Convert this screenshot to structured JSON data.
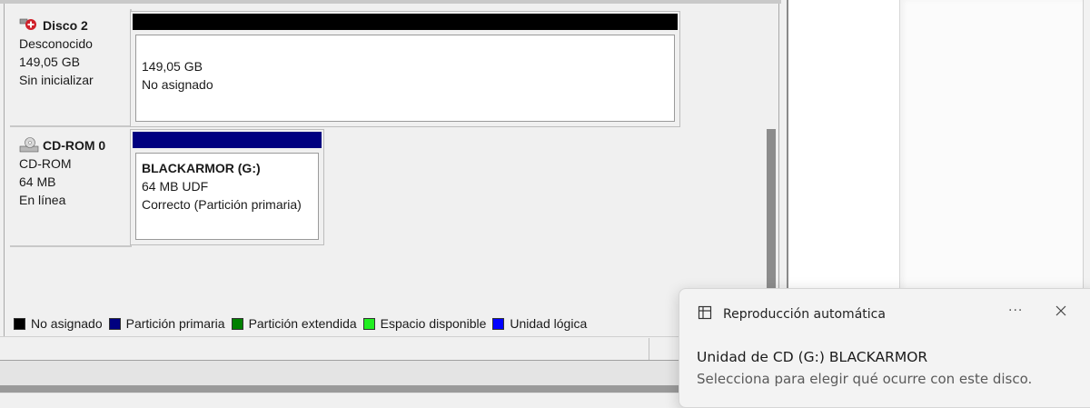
{
  "disks": [
    {
      "name": "Disco 2",
      "type": "Desconocido",
      "size": "149,05 GB",
      "status": "Sin inicializar",
      "icon": "disk-uninitialized-icon",
      "partition": {
        "size": "149,05 GB",
        "status": "No asignado",
        "bar_color": "#000000"
      }
    },
    {
      "name": "CD-ROM 0",
      "type": "CD-ROM",
      "size": "64 MB",
      "status": "En línea",
      "icon": "cdrom-icon",
      "partition": {
        "label": "BLACKARMOR  (G:)",
        "size": "64 MB UDF",
        "status": "Correcto (Partición primaria)",
        "bar_color": "#000080"
      }
    }
  ],
  "legend": [
    {
      "label": "No asignado",
      "color": "#000000"
    },
    {
      "label": "Partición primaria",
      "color": "#000080"
    },
    {
      "label": "Partición extendida",
      "color": "#008000"
    },
    {
      "label": "Espacio disponible",
      "color": "#22ee22"
    },
    {
      "label": "Unidad lógica",
      "color": "#0000ff"
    }
  ],
  "toast": {
    "app": "Reproducción automática",
    "more": "···",
    "title": "Unidad de CD (G:) BLACKARMOR",
    "description": "Selecciona para elegir qué ocurre con este disco."
  }
}
